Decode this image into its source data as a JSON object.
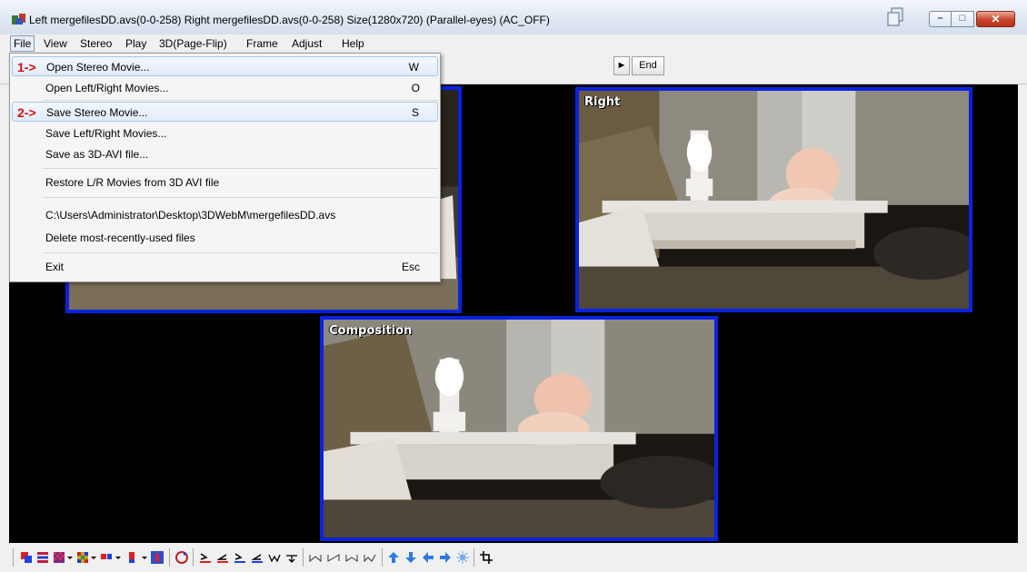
{
  "window": {
    "title": "Left mergefilesDD.avs(0-0-258) Right mergefilesDD.avs(0-0-258) Size(1280x720)  (Parallel-eyes) (AC_OFF)",
    "controls": {
      "minimize": "–",
      "maximize": "□",
      "close": "✕"
    }
  },
  "menubar": {
    "items": [
      {
        "label": "File"
      },
      {
        "label": "View"
      },
      {
        "label": "Stereo"
      },
      {
        "label": "Play"
      },
      {
        "label": "3D(Page-Flip)"
      },
      {
        "label": "Frame"
      },
      {
        "label": "Adjust"
      },
      {
        "label": "Help"
      }
    ]
  },
  "navigation": {
    "next_glyph": "►",
    "end_label": "End"
  },
  "file_menu": {
    "items": [
      {
        "marker": "1->",
        "label": "Open Stereo Movie...",
        "shortcut": "W"
      },
      {
        "marker": "",
        "label": "Open Left/Right Movies...",
        "shortcut": "O"
      },
      {
        "marker": "2->",
        "label": "Save Stereo Movie...",
        "shortcut": "S"
      },
      {
        "marker": "",
        "label": "Save Left/Right Movies...",
        "shortcut": ""
      },
      {
        "marker": "",
        "label": "Save as 3D-AVI file...",
        "shortcut": ""
      },
      {
        "marker": "",
        "label": "Restore L/R Movies from 3D AVI file",
        "shortcut": ""
      },
      {
        "marker": "",
        "label": "C:\\Users\\Administrator\\Desktop\\3DWebM\\mergefilesDD.avs",
        "shortcut": ""
      },
      {
        "marker": "",
        "label": "Delete most-recently-used files",
        "shortcut": ""
      },
      {
        "marker": "",
        "label": "Exit",
        "shortcut": "Esc"
      }
    ]
  },
  "panes": {
    "right_label": "Right",
    "composition_label": "Composition"
  },
  "colors": {
    "pane_border": "#0b22e0",
    "marker": "#d01010",
    "viewer_bg": "#000000"
  },
  "bottom_toolbar": {
    "icons": [
      "anaglyph-icon",
      "lines-icon",
      "checker-icon",
      "dropdown-arrow-icon",
      "checker-color-icon",
      "dropdown-arrow-icon",
      "side-by-side-icon",
      "dropdown-arrow-icon",
      "red-blue-bar-icon",
      "dropdown-arrow-icon",
      "person-stereo-icon",
      "swap-icon",
      "align-left-icon",
      "align-left2-icon",
      "align-right-icon",
      "align-right2-icon",
      "adjust-wave-icon",
      "adjust-down-icon",
      "step-icon",
      "step2-icon",
      "step3-icon",
      "step4-icon",
      "arrow-up-icon",
      "arrow-down-icon",
      "arrow-left-icon",
      "arrow-right-icon",
      "reset-icon",
      "crop-icon"
    ]
  }
}
